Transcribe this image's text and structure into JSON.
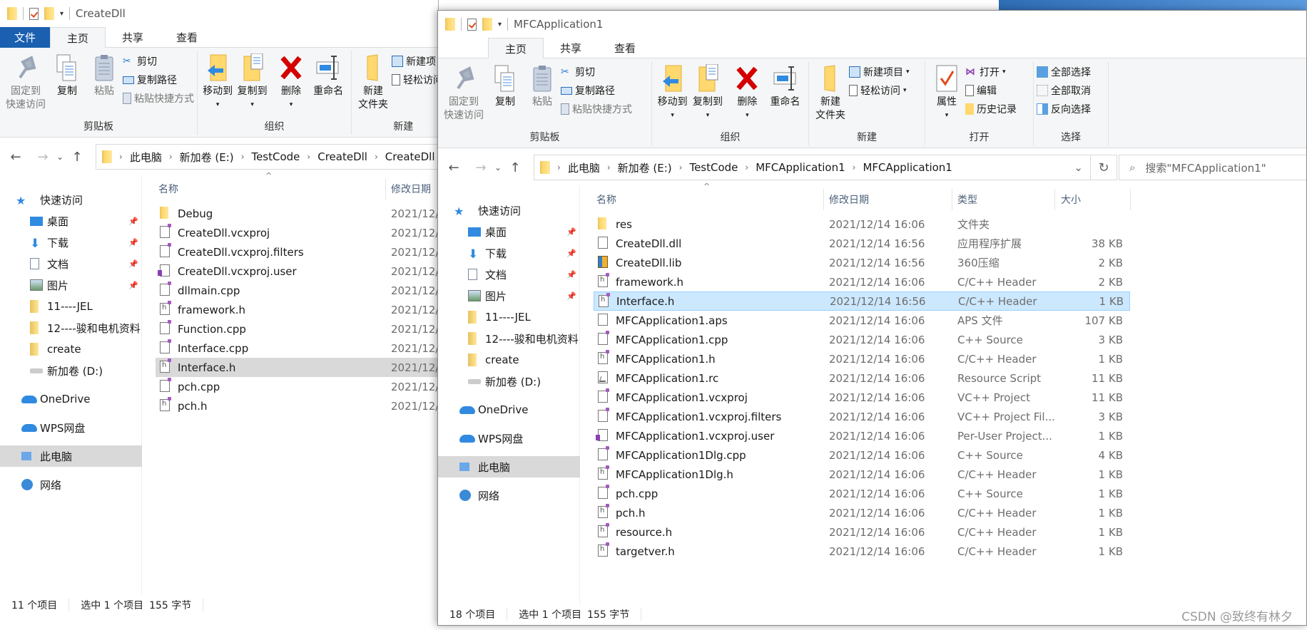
{
  "colors": {
    "file_tab": "#1a5fb0",
    "selection_active": "#cce8ff",
    "selection_inactive": "#d9d9d9",
    "ribbon_bg": "#f5f6f7",
    "delete_red": "#d40000"
  },
  "watermark": "CSDN @致终有林夕",
  "windows": {
    "left": {
      "title": "CreateDll",
      "tabs": [
        "文件",
        "主页",
        "共享",
        "查看"
      ],
      "active_tab": "主页",
      "ribbon": {
        "clipboard": {
          "label": "剪贴板",
          "pin": "固定到快速访问",
          "pin_l1": "固定到",
          "pin_l2": "快速访问",
          "copy": "复制",
          "paste": "粘贴",
          "cut": "剪切",
          "copy_path": "复制路径",
          "paste_shortcut": "粘贴快捷方式"
        },
        "organize": {
          "label": "组织",
          "move_to": "移动到",
          "copy_to": "复制到",
          "delete": "删除",
          "rename": "重命名"
        },
        "new": {
          "label": "新建",
          "new_folder_l1": "新建",
          "new_folder_l2": "文件夹",
          "new_item": "新建项目",
          "easy_access": "轻松访问"
        }
      },
      "breadcrumb": [
        "此电脑",
        "新加卷 (E:)",
        "TestCode",
        "CreateDll",
        "CreateDll"
      ],
      "nav": [
        {
          "label": "快速访问",
          "icon": "star",
          "level": 0
        },
        {
          "label": "桌面",
          "icon": "desktop",
          "level": 1,
          "pinned": true
        },
        {
          "label": "下载",
          "icon": "download",
          "level": 1,
          "pinned": true
        },
        {
          "label": "文档",
          "icon": "document",
          "level": 1,
          "pinned": true
        },
        {
          "label": "图片",
          "icon": "picture",
          "level": 1,
          "pinned": true
        },
        {
          "label": "11----JEL",
          "icon": "folder",
          "level": 1
        },
        {
          "label": "12----骏和电机资料",
          "icon": "folder",
          "level": 1
        },
        {
          "label": "create",
          "icon": "folder",
          "level": 1
        },
        {
          "label": "新加卷 (D:)",
          "icon": "drive",
          "level": 1
        },
        {
          "label": "OneDrive",
          "icon": "cloud",
          "level": 0
        },
        {
          "label": "WPS网盘",
          "icon": "cloud",
          "level": 0
        },
        {
          "label": "此电脑",
          "icon": "computer",
          "level": 0,
          "selected": true
        },
        {
          "label": "网络",
          "icon": "network",
          "level": 0
        }
      ],
      "columns": {
        "name": "名称",
        "date": "修改日期"
      },
      "files": [
        {
          "name": "Debug",
          "icon": "folder",
          "date": "2021/12/"
        },
        {
          "name": "CreateDll.vcxproj",
          "icon": "vcxproj",
          "date": "2021/12/"
        },
        {
          "name": "CreateDll.vcxproj.filters",
          "icon": "filters",
          "date": "2021/12/"
        },
        {
          "name": "CreateDll.vcxproj.user",
          "icon": "user",
          "date": "2021/12/"
        },
        {
          "name": "dllmain.cpp",
          "icon": "cpp",
          "date": "2021/12/"
        },
        {
          "name": "framework.h",
          "icon": "h",
          "date": "2021/12/"
        },
        {
          "name": "Function.cpp",
          "icon": "cpp",
          "date": "2021/12/"
        },
        {
          "name": "Interface.cpp",
          "icon": "cpp",
          "date": "2021/12/"
        },
        {
          "name": "Interface.h",
          "icon": "h",
          "date": "2021/12/",
          "selected": true
        },
        {
          "name": "pch.cpp",
          "icon": "cpp",
          "date": "2021/12/"
        },
        {
          "name": "pch.h",
          "icon": "h",
          "date": "2021/12/"
        }
      ],
      "status": {
        "count": "11 个项目",
        "selected": "选中 1 个项目",
        "size": "155 字节"
      }
    },
    "right": {
      "title": "MFCApplication1",
      "tabs": [
        "主页",
        "共享",
        "查看"
      ],
      "active_tab": "主页",
      "ribbon": {
        "clipboard": {
          "label": "剪贴板",
          "pin_l1": "固定到",
          "pin_l2": "快速访问",
          "copy": "复制",
          "paste": "粘贴",
          "cut": "剪切",
          "copy_path": "复制路径",
          "paste_shortcut": "粘贴快捷方式"
        },
        "organize": {
          "label": "组织",
          "move_to": "移动到",
          "copy_to": "复制到",
          "delete": "删除",
          "rename": "重命名"
        },
        "new": {
          "label": "新建",
          "new_folder_l1": "新建",
          "new_folder_l2": "文件夹",
          "new_item": "新建项目",
          "easy_access": "轻松访问"
        },
        "open": {
          "label": "打开",
          "properties": "属性",
          "open": "打开",
          "edit": "编辑",
          "history": "历史记录"
        },
        "select": {
          "label": "选择",
          "select_all": "全部选择",
          "select_none": "全部取消",
          "invert": "反向选择"
        }
      },
      "breadcrumb": [
        "此电脑",
        "新加卷 (E:)",
        "TestCode",
        "MFCApplication1",
        "MFCApplication1"
      ],
      "search_placeholder": "搜索\"MFCApplication1\"",
      "nav": [
        {
          "label": "快速访问",
          "icon": "star",
          "level": 0
        },
        {
          "label": "桌面",
          "icon": "desktop",
          "level": 1,
          "pinned": true
        },
        {
          "label": "下载",
          "icon": "download",
          "level": 1,
          "pinned": true
        },
        {
          "label": "文档",
          "icon": "document",
          "level": 1,
          "pinned": true
        },
        {
          "label": "图片",
          "icon": "picture",
          "level": 1,
          "pinned": true
        },
        {
          "label": "11----JEL",
          "icon": "folder",
          "level": 1
        },
        {
          "label": "12----骏和电机资料",
          "icon": "folder",
          "level": 1
        },
        {
          "label": "create",
          "icon": "folder",
          "level": 1
        },
        {
          "label": "新加卷 (D:)",
          "icon": "drive",
          "level": 1
        },
        {
          "label": "OneDrive",
          "icon": "cloud",
          "level": 0
        },
        {
          "label": "WPS网盘",
          "icon": "cloud",
          "level": 0
        },
        {
          "label": "此电脑",
          "icon": "computer",
          "level": 0,
          "selected": true
        },
        {
          "label": "网络",
          "icon": "network",
          "level": 0
        }
      ],
      "columns": {
        "name": "名称",
        "date": "修改日期",
        "type": "类型",
        "size": "大小"
      },
      "files": [
        {
          "name": "res",
          "icon": "folder",
          "date": "2021/12/14 16:06",
          "type": "文件夹",
          "size": ""
        },
        {
          "name": "CreateDll.dll",
          "icon": "dll",
          "date": "2021/12/14 16:56",
          "type": "应用程序扩展",
          "size": "38 KB"
        },
        {
          "name": "CreateDll.lib",
          "icon": "lib",
          "date": "2021/12/14 16:56",
          "type": "360压缩",
          "size": "2 KB"
        },
        {
          "name": "framework.h",
          "icon": "h",
          "date": "2021/12/14 16:06",
          "type": "C/C++ Header",
          "size": "2 KB"
        },
        {
          "name": "Interface.h",
          "icon": "h",
          "date": "2021/12/14 16:56",
          "type": "C/C++ Header",
          "size": "1 KB",
          "selected": true
        },
        {
          "name": "MFCApplication1.aps",
          "icon": "file",
          "date": "2021/12/14 16:06",
          "type": "APS 文件",
          "size": "107 KB"
        },
        {
          "name": "MFCApplication1.cpp",
          "icon": "cpp",
          "date": "2021/12/14 16:06",
          "type": "C++ Source",
          "size": "3 KB"
        },
        {
          "name": "MFCApplication1.h",
          "icon": "h",
          "date": "2021/12/14 16:06",
          "type": "C/C++ Header",
          "size": "1 KB"
        },
        {
          "name": "MFCApplication1.rc",
          "icon": "rc",
          "date": "2021/12/14 16:06",
          "type": "Resource Script",
          "size": "11 KB"
        },
        {
          "name": "MFCApplication1.vcxproj",
          "icon": "vcxproj",
          "date": "2021/12/14 16:06",
          "type": "VC++ Project",
          "size": "11 KB"
        },
        {
          "name": "MFCApplication1.vcxproj.filters",
          "icon": "filters",
          "date": "2021/12/14 16:06",
          "type": "VC++ Project Fil...",
          "size": "3 KB"
        },
        {
          "name": "MFCApplication1.vcxproj.user",
          "icon": "user",
          "date": "2021/12/14 16:06",
          "type": "Per-User Project...",
          "size": "1 KB"
        },
        {
          "name": "MFCApplication1Dlg.cpp",
          "icon": "cpp",
          "date": "2021/12/14 16:06",
          "type": "C++ Source",
          "size": "4 KB"
        },
        {
          "name": "MFCApplication1Dlg.h",
          "icon": "h",
          "date": "2021/12/14 16:06",
          "type": "C/C++ Header",
          "size": "1 KB"
        },
        {
          "name": "pch.cpp",
          "icon": "cpp",
          "date": "2021/12/14 16:06",
          "type": "C++ Source",
          "size": "1 KB"
        },
        {
          "name": "pch.h",
          "icon": "h",
          "date": "2021/12/14 16:06",
          "type": "C/C++ Header",
          "size": "1 KB"
        },
        {
          "name": "resource.h",
          "icon": "h",
          "date": "2021/12/14 16:06",
          "type": "C/C++ Header",
          "size": "1 KB"
        },
        {
          "name": "targetver.h",
          "icon": "h",
          "date": "2021/12/14 16:06",
          "type": "C/C++ Header",
          "size": "1 KB"
        }
      ],
      "status": {
        "count": "18 个项目",
        "selected": "选中 1 个项目",
        "size": "155 字节"
      }
    }
  }
}
